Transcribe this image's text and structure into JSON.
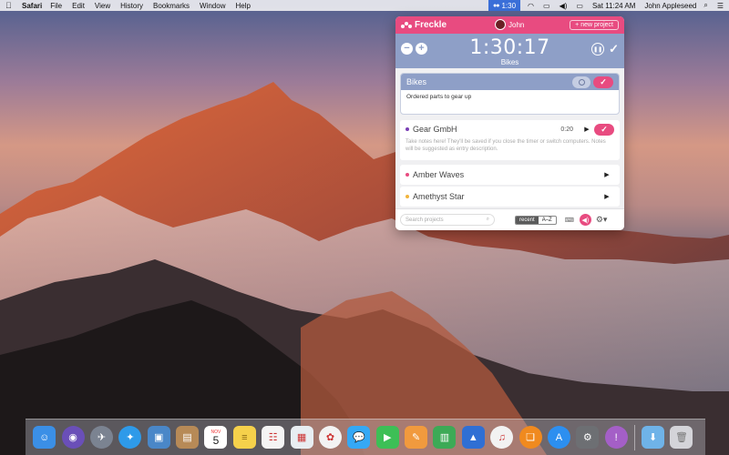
{
  "menubar": {
    "app_name": "Safari",
    "menus": [
      "File",
      "Edit",
      "View",
      "History",
      "Bookmarks",
      "Window",
      "Help"
    ],
    "tray_time": "1:30",
    "clock": "Sat 11:24 AM",
    "user": "John Appleseed"
  },
  "freckle": {
    "brand": "Freckle",
    "user": "John",
    "new_project_label": "+ new project",
    "timer": "1:30:17",
    "timer_project": "Bikes",
    "active": {
      "name": "Bikes",
      "note": "Ordered parts to gear up"
    },
    "projects": [
      {
        "name": "Gear GmbH",
        "time": "0:20",
        "color": "#7a3fb5",
        "hint": "Take notes here! They'll be saved if you close the timer or switch computers. Notes will be suggested as entry description."
      },
      {
        "name": "Amber Waves",
        "time": "",
        "color": "#e84b80"
      },
      {
        "name": "Amethyst Star",
        "time": "",
        "color": "#f2b43c"
      }
    ],
    "search_placeholder": "Search projects",
    "sort_recent": "recent",
    "sort_az": "A–Z"
  },
  "dock": {
    "calendar_month": "NOV",
    "calendar_day": "5",
    "apps": [
      {
        "icon": "finder-icon",
        "color": "#3b8fe6"
      },
      {
        "icon": "siri-icon",
        "color": "#6a4fb8"
      },
      {
        "icon": "launchpad-icon",
        "color": "#7b8391"
      },
      {
        "icon": "safari-icon",
        "color": "#2e9ae9"
      },
      {
        "icon": "photo-slideshow-icon",
        "color": "#4a87c8"
      },
      {
        "icon": "contacts-icon",
        "color": "#b78a57"
      },
      {
        "icon": "calendar-icon",
        "color": "#ffffff"
      },
      {
        "icon": "notes-icon",
        "color": "#f5d14b"
      },
      {
        "icon": "reminders-icon",
        "color": "#f4f4f4"
      },
      {
        "icon": "preview-icon",
        "color": "#e8eef2"
      },
      {
        "icon": "photos-icon",
        "color": "#f3f3f3"
      },
      {
        "icon": "messages-icon",
        "color": "#35a8f5"
      },
      {
        "icon": "facetime-icon",
        "color": "#3dbf56"
      },
      {
        "icon": "pages-icon",
        "color": "#f19a3e"
      },
      {
        "icon": "numbers-icon",
        "color": "#3daa56"
      },
      {
        "icon": "keynote-icon",
        "color": "#2f6fd4"
      },
      {
        "icon": "itunes-icon",
        "color": "#f2f2f2"
      },
      {
        "icon": "ibooks-icon",
        "color": "#f08a1f"
      },
      {
        "icon": "app-store-icon",
        "color": "#2c8ff0"
      },
      {
        "icon": "system-preferences-icon",
        "color": "#6d6f73"
      },
      {
        "icon": "freckle-icon",
        "color": "#a45fc7"
      }
    ],
    "folder_icon": "downloads-folder-icon",
    "trash_icon": "trash-icon"
  }
}
